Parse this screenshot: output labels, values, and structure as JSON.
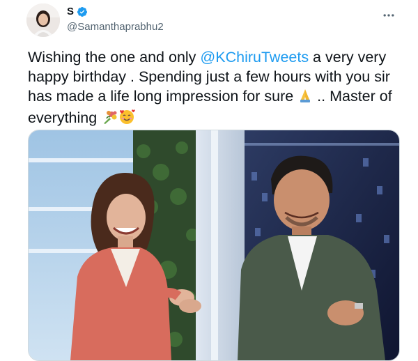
{
  "author": {
    "display_name": "S",
    "handle": "@Samanthaprabhu2",
    "verified": true,
    "avatar_icon": "profile-photo"
  },
  "tweet": {
    "text_before_mention": "Wishing the one and only ",
    "mention": "@KChiruTweets",
    "text_after_mention": " a very very happy birthday . Spending just a few hours with you sir has made a life long impression for sure ",
    "text_after_emoji1": " .. Master of everything ",
    "emoji_1": "folded-hands",
    "emoji_2": "bouquet",
    "emoji_3": "smiling-face-with-hearts"
  },
  "media": {
    "type": "photo",
    "description_icon": "tweet-photo"
  },
  "colors": {
    "accent": "#1d9bf0",
    "secondary_text": "#536471",
    "primary_text": "#0f1419"
  }
}
